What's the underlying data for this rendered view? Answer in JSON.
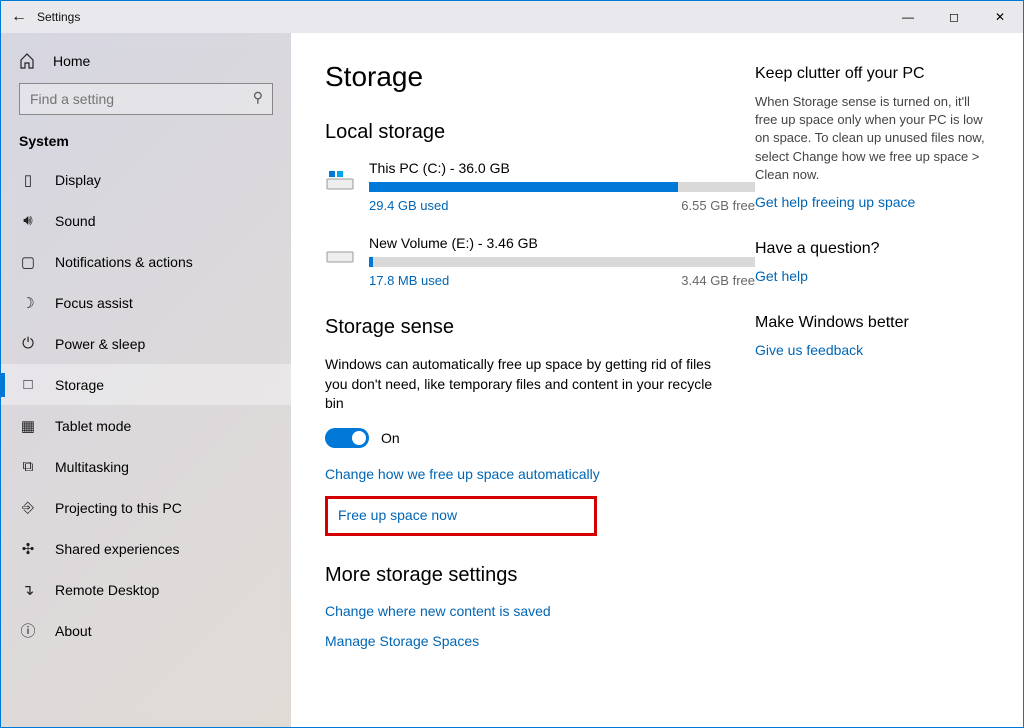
{
  "titlebar": {
    "title": "Settings"
  },
  "sidebar": {
    "home": "Home",
    "search_placeholder": "Find a setting",
    "category": "System",
    "items": [
      {
        "label": "Display"
      },
      {
        "label": "Sound"
      },
      {
        "label": "Notifications & actions"
      },
      {
        "label": "Focus assist"
      },
      {
        "label": "Power & sleep"
      },
      {
        "label": "Storage"
      },
      {
        "label": "Tablet mode"
      },
      {
        "label": "Multitasking"
      },
      {
        "label": "Projecting to this PC"
      },
      {
        "label": "Shared experiences"
      },
      {
        "label": "Remote Desktop"
      },
      {
        "label": "About"
      }
    ]
  },
  "page": {
    "title": "Storage",
    "local_heading": "Local storage",
    "drives": [
      {
        "name": "This PC (C:) - 36.0 GB",
        "used": "29.4 GB used",
        "free": "6.55 GB free",
        "pct": 80
      },
      {
        "name": "New Volume (E:) - 3.46 GB",
        "used": "17.8 MB used",
        "free": "3.44 GB free",
        "pct": 1
      }
    ],
    "sense_heading": "Storage sense",
    "sense_desc": "Windows can automatically free up space by getting rid of files you don't need, like temporary files and content in your recycle bin",
    "toggle_state": "On",
    "link_change": "Change how we free up space automatically",
    "link_free_now": "Free up space now",
    "more_heading": "More storage settings",
    "link_where": "Change where new content is saved",
    "link_spaces": "Manage Storage Spaces"
  },
  "aside": {
    "tip_heading": "Keep clutter off your PC",
    "tip_body": "When Storage sense is turned on, it'll free up space only when your PC is low on space. To clean up unused files now, select Change how we free up space > Clean now.",
    "tip_link": "Get help freeing up space",
    "q_heading": "Have a question?",
    "q_link": "Get help",
    "fb_heading": "Make Windows better",
    "fb_link": "Give us feedback"
  }
}
